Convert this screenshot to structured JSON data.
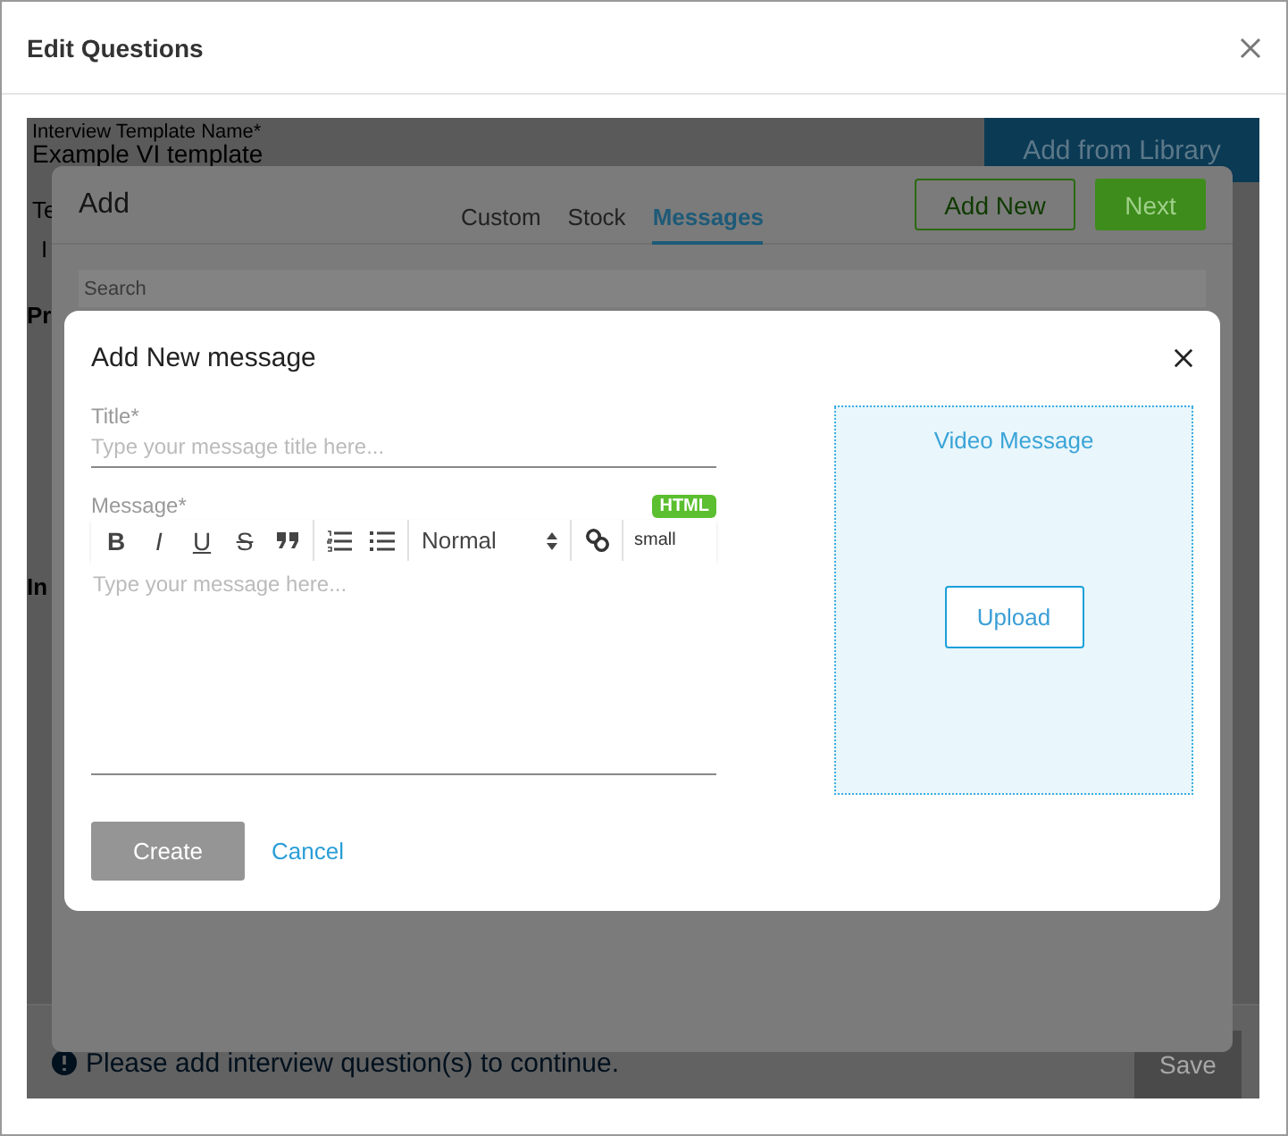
{
  "window": {
    "title": "Edit Questions"
  },
  "background_form": {
    "template_name_label": "Interview Template Name*",
    "template_name_value": "Example VI template",
    "add_from_library": "Add from Library",
    "fragments": [
      "Te",
      "I",
      "Pr",
      "In"
    ],
    "notice": "Please add interview question(s) to continue.",
    "save": "Save"
  },
  "add_dialog": {
    "title": "Add",
    "tabs": [
      {
        "label": "Custom",
        "selected": false
      },
      {
        "label": "Stock",
        "selected": false
      },
      {
        "label": "Messages",
        "selected": true
      }
    ],
    "add_new": "Add New",
    "next": "Next",
    "search_placeholder": "Search"
  },
  "message_dialog": {
    "title": "Add New message",
    "title_field": {
      "label": "Title*",
      "placeholder": "Type your message title here..."
    },
    "message_field": {
      "label": "Message*",
      "badge": "HTML",
      "placeholder": "Type your message here..."
    },
    "toolbar_groups": [
      [
        {
          "kind": "bold",
          "label": "B"
        },
        {
          "kind": "italic",
          "label": "I"
        },
        {
          "kind": "underline",
          "label": "U"
        },
        {
          "kind": "strike",
          "label": "S"
        },
        {
          "kind": "quote"
        }
      ],
      [
        {
          "kind": "ordered-list"
        },
        {
          "kind": "bullet-list"
        }
      ],
      [
        {
          "kind": "select",
          "label": "Normal"
        }
      ],
      [
        {
          "kind": "link"
        }
      ],
      [
        {
          "kind": "text",
          "label": "small"
        }
      ]
    ],
    "video": {
      "heading": "Video Message",
      "upload": "Upload"
    },
    "create": {
      "label": "Create",
      "disabled": true
    },
    "cancel": "Cancel"
  }
}
